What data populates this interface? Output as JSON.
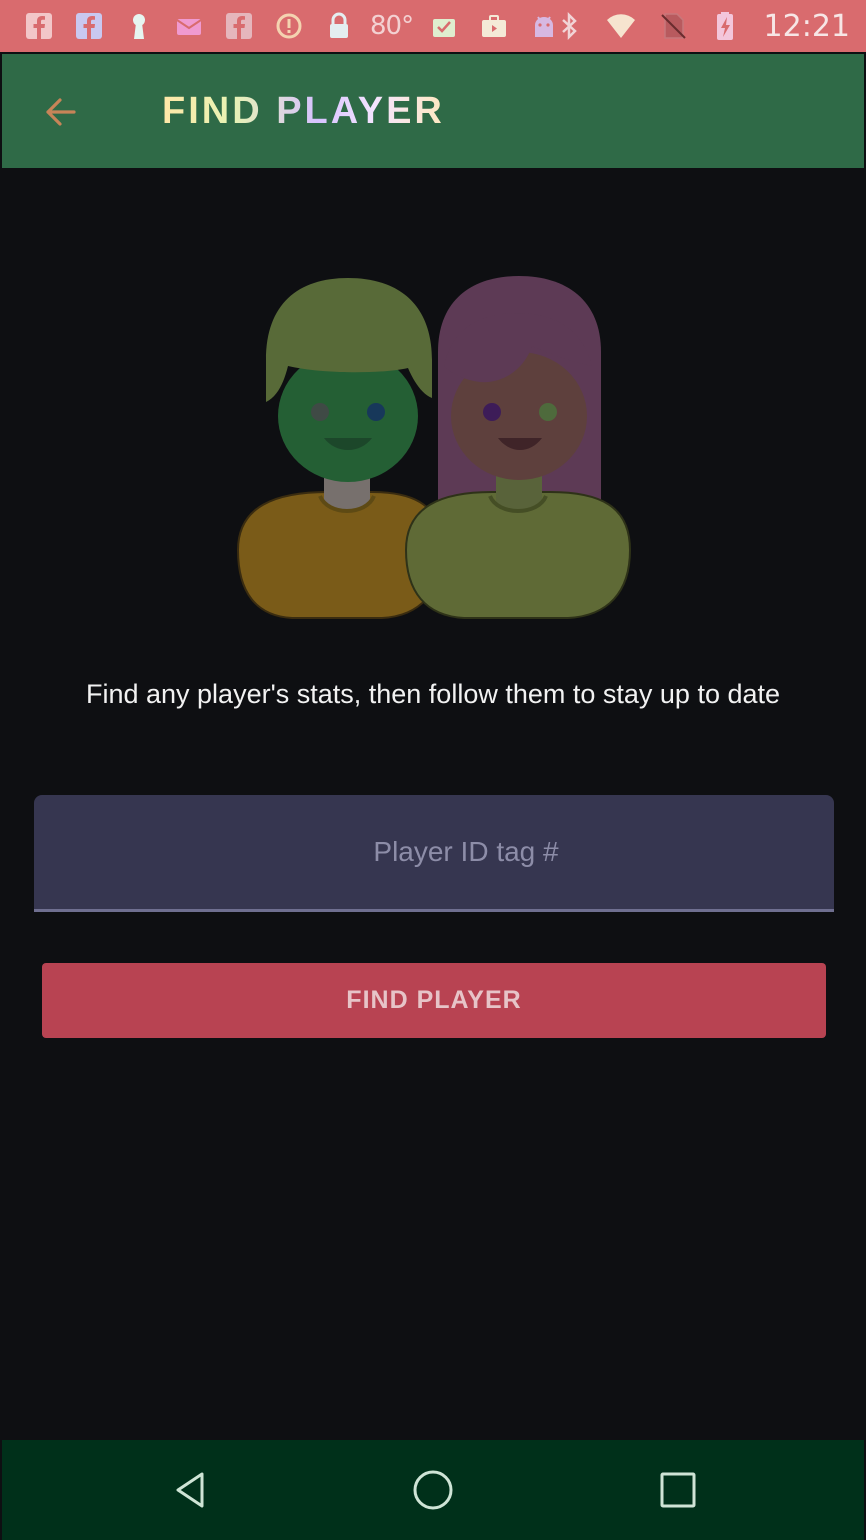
{
  "status_bar": {
    "temperature": "80°",
    "time": "12:21",
    "left_icons": [
      "facebook-icon",
      "facebook-icon",
      "keyhole-icon",
      "mail-icon",
      "facebook-icon",
      "alert-icon",
      "lock-icon",
      "temperature-text",
      "clipboard-icon",
      "briefcase-icon",
      "android-icon"
    ],
    "right_icons": [
      "bluetooth-icon",
      "wifi-icon",
      "no-sim-icon",
      "battery-charging-icon"
    ]
  },
  "app_bar": {
    "title": "FIND PLAYER",
    "back_icon": "arrow-left-icon"
  },
  "hero": {
    "icon": "two-people-avatars-icon"
  },
  "main": {
    "description": "Find any player's stats, then follow them to stay up to date",
    "player_id_placeholder": "Player ID tag #",
    "player_id_value": "",
    "find_button_label": "FIND PLAYER"
  },
  "nav_bar": {
    "back_icon": "triangle-back-icon",
    "home_icon": "circle-home-icon",
    "recents_icon": "square-recents-icon"
  },
  "colors": {
    "status_bar": "#d96b6e",
    "app_bar": "#2f6a47",
    "background": "#0e0f12",
    "input": "#363650",
    "button": "#b84352",
    "nav_bar": "#00301a"
  }
}
